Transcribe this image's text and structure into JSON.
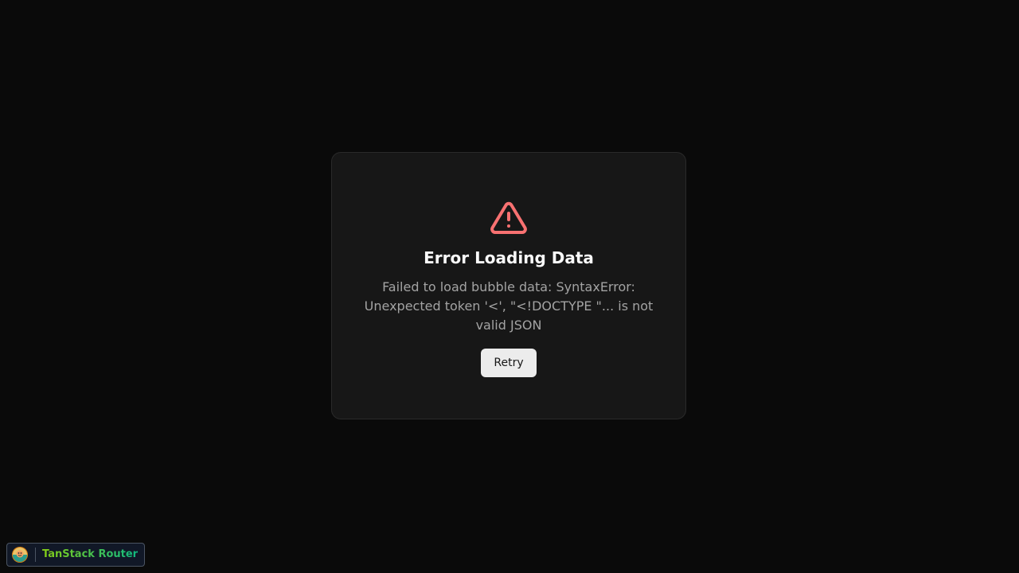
{
  "error": {
    "icon": "warning-triangle-icon",
    "title": "Error Loading Data",
    "message": "Failed to load bubble data: SyntaxError: Unexpected token '<', \"<!DOCTYPE \"... is not valid JSON",
    "retry_label": "Retry"
  },
  "devtools": {
    "logo_icon": "tanstack-logo-icon",
    "label": "TanStack Router"
  },
  "colors": {
    "background": "#0a0a0a",
    "card": "#171717",
    "warning": "#f87171",
    "devtools_accent": "#84cc16"
  }
}
